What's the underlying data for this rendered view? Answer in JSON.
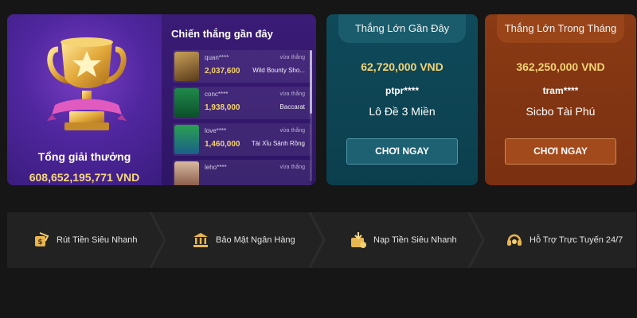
{
  "jackpot": {
    "total_label": "Tổng giải thưởng",
    "total_value": "608,652,195,771 VND"
  },
  "recent_wins": {
    "title": "Chiến thắng gần đây",
    "items": [
      {
        "user": "quan****",
        "tag": "vừa thắng",
        "amount": "2,037,600",
        "game": "Wild Bounty Sho..."
      },
      {
        "user": "conc****",
        "tag": "vừa thắng",
        "amount": "1,938,000",
        "game": "Baccarat"
      },
      {
        "user": "love****",
        "tag": "vừa thắng",
        "amount": "1,460,000",
        "game": "Tài Xỉu Sảnh Rồng"
      },
      {
        "user": "leho****",
        "tag": "vừa thắng",
        "amount": "",
        "game": ""
      }
    ]
  },
  "recent_big_win": {
    "title": "Thắng Lớn Gần Đây",
    "amount": "62,720,000 VND",
    "user": "ptpr****",
    "game": "Lô Đề 3 Miền",
    "button": "CHƠI NGAY"
  },
  "monthly_big_win": {
    "title": "Thắng Lớn Trong Tháng",
    "amount": "362,250,000 VND",
    "user": "tram****",
    "game": "Sicbo Tài Phú",
    "button": "CHƠI NGAY"
  },
  "features": [
    {
      "label": "Rút Tiền Siêu Nhanh",
      "icon": "cash-withdraw-icon"
    },
    {
      "label": "Bảo Mật Ngân Hàng",
      "icon": "bank-security-icon"
    },
    {
      "label": "Nạp Tiền Siêu Nhanh",
      "icon": "deposit-icon"
    },
    {
      "label": "Hỗ Trợ Trực Tuyến 24/7",
      "icon": "headset-support-icon"
    }
  ],
  "colors": {
    "background": "#161616",
    "gold": "#f3d373",
    "teal_card": "#0f4a5a",
    "orange_card": "#8a3a14",
    "purple_panel": "#5c2a9e"
  }
}
